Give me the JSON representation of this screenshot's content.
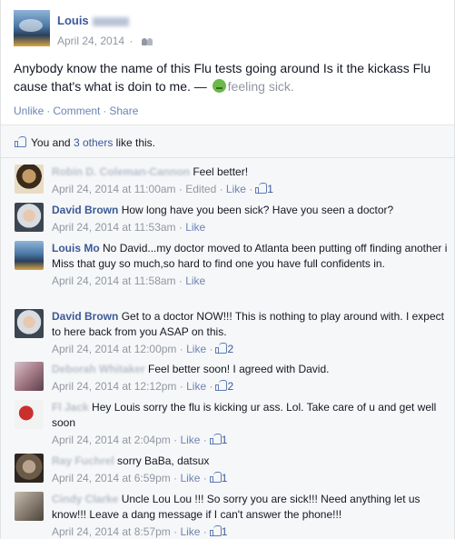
{
  "post": {
    "author_first": "Louis",
    "date": "April 24, 2014",
    "text": "Anybody know the name of this Flu tests going around Is it the kickass Flu cause that's what is doin to me. —",
    "feeling": "feeling sick.",
    "actions": [
      "Unlike",
      "Comment",
      "Share"
    ],
    "likes_prefix": "You and",
    "likes_others": "3 others",
    "likes_suffix": "like this.",
    "icons": {
      "audience": "friends-icon",
      "feeling": "sick-emoji-icon",
      "like": "thumbs-up-icon"
    }
  },
  "comments": [
    {
      "name": "Robin D. Coleman-Cannon",
      "name_blurred": true,
      "text": "Feel better!",
      "time": "April 24, 2014 at 11:00am",
      "edited": "Edited",
      "like": "Like",
      "count": "1",
      "avatar_color": "#7a5a3a"
    },
    {
      "name": "David Brown",
      "name_blurred": false,
      "text": "How long have you been sick? Have you seen a doctor?",
      "time": "April 24, 2014 at 11:53am",
      "like": "Like",
      "count": "",
      "avatar_color": "#9aa3ad"
    },
    {
      "name": "Louis Mo",
      "name_blurred": false,
      "text": "No David...my doctor moved to Atlanta been putting off finding another i",
      "text2": "Miss that guy so much,so hard to find one you have full confidents in.",
      "time": "April 24, 2014 at 11:58am",
      "like": "Like",
      "count": "",
      "avatar_color": "#4a78a6"
    },
    {
      "name": "David Brown",
      "name_blurred": false,
      "text": "Get to a doctor NOW!!! This is nothing to play around with. I expect to here back from you ASAP on this.",
      "time": "April 24, 2014 at 12:00pm",
      "like": "Like",
      "count": "2",
      "avatar_color": "#9aa3ad"
    },
    {
      "name": "Deborah Whitaker",
      "name_blurred": true,
      "text": "Feel better soon! I agreed with David.",
      "time": "April 24, 2014 at 12:12pm",
      "like": "Like",
      "count": "2",
      "avatar_color": "#a37a86"
    },
    {
      "name": "Fl Jack",
      "name_blurred": true,
      "text": "Hey Louis sorry the flu is kicking ur ass. Lol. Take care of u and get well soon",
      "time": "April 24, 2014 at 2:04pm",
      "like": "Like",
      "count": "1",
      "avatar_color": "#c9302c"
    },
    {
      "name": "Ray Fuchrel",
      "name_blurred": true,
      "text": "sorry BaBa, datsux",
      "time": "April 24, 2014 at 6:59pm",
      "like": "Like",
      "count": "1",
      "avatar_color": "#6b5a48"
    },
    {
      "name": "Cindy Clarke",
      "name_blurred": true,
      "text": "Uncle Lou Lou !!! So sorry you are sick!!! Need anything let us know!!! Leave a dang message if I can't answer the phone!!!",
      "time": "April 24, 2014 at 8:57pm",
      "like": "Like",
      "count": "1",
      "avatar_color": "#8a7f72"
    }
  ]
}
